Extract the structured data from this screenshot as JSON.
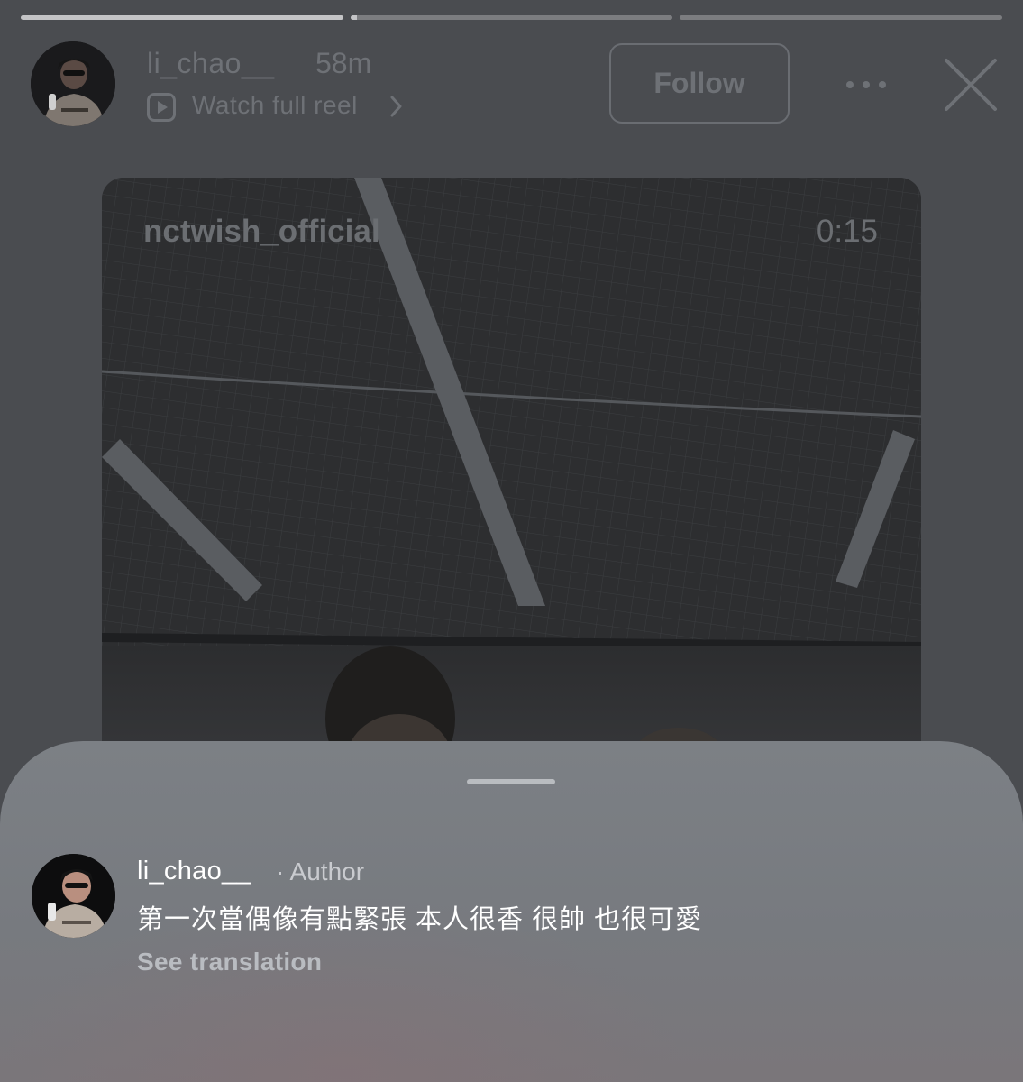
{
  "story": {
    "progress_segments": [
      1,
      0.02,
      0
    ]
  },
  "header": {
    "username": "li_chao__",
    "time": "58m",
    "watch_reel_label": "Watch full reel",
    "follow_label": "Follow",
    "icons": [
      "reel-icon",
      "chevron-right-icon",
      "more-icon",
      "close-icon"
    ]
  },
  "reel": {
    "username": "nctwish_official",
    "duration": "0:15"
  },
  "comment_sheet": {
    "username": "li_chao__",
    "author_tag": "· Author",
    "text": "第一次當偶像有點緊張 本人很香 很帥 也很可愛",
    "see_translation_label": "See translation"
  },
  "colors": {
    "background": "#4a4c50",
    "sheet": "#7c8085",
    "text_primary": "#ffffff",
    "text_dim": "#6e7176"
  }
}
